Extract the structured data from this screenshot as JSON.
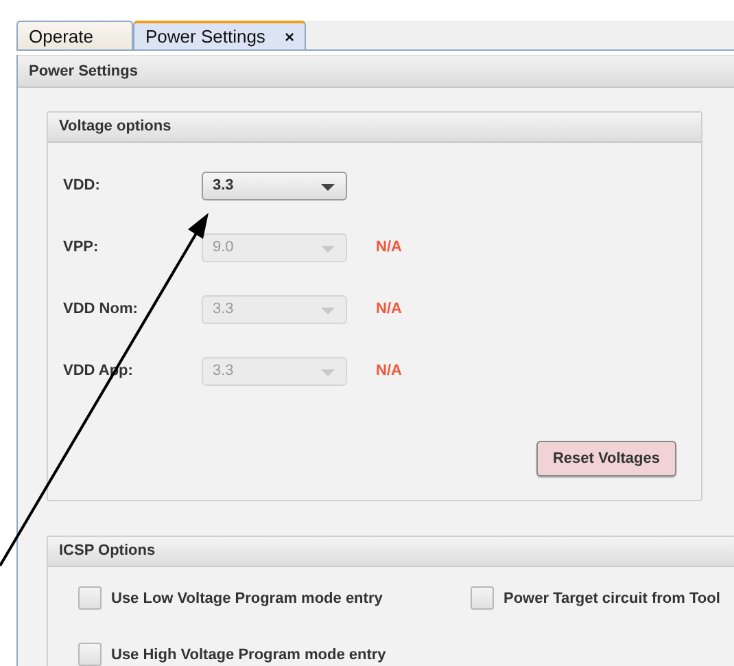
{
  "tabs": [
    {
      "label": "Operate",
      "selected": false
    },
    {
      "label": "Power Settings",
      "selected": true,
      "close": "×"
    }
  ],
  "panel": {
    "title": "Power Settings"
  },
  "voltage_options": {
    "title": "Voltage options",
    "rows": [
      {
        "label": "VDD:",
        "value": "3.3",
        "disabled": false
      },
      {
        "label": "VPP:",
        "value": "9.0",
        "disabled": true,
        "note": "N/A"
      },
      {
        "label": "VDD Nom:",
        "value": "3.3",
        "disabled": true,
        "note": "N/A"
      },
      {
        "label": "VDD App:",
        "value": "3.3",
        "disabled": true,
        "note": "N/A"
      }
    ],
    "button": "Reset Voltages"
  },
  "icsp_options": {
    "title": "ICSP Options",
    "checkboxes": [
      {
        "label": "Use Low Voltage Program mode entry",
        "checked": false
      },
      {
        "label": "Power Target circuit from Tool",
        "checked": false
      },
      {
        "label": "Use High Voltage Program mode entry",
        "checked": false
      }
    ]
  }
}
